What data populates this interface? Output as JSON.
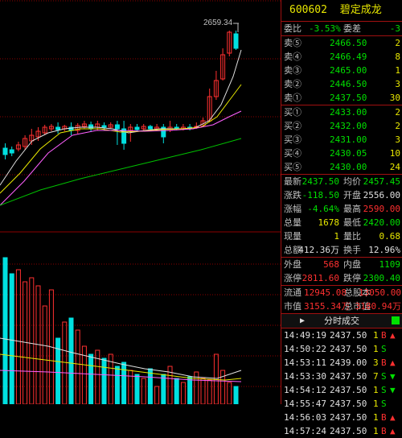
{
  "stock": {
    "code": "600602",
    "name": "碧定成龙"
  },
  "ratio": {
    "wb_label": "委比",
    "wb_value": "-3.53%",
    "wc_label": "委差",
    "wc_value": "-3"
  },
  "sell": [
    {
      "label": "卖⑤",
      "price": "2466.50",
      "vol": "2"
    },
    {
      "label": "卖④",
      "price": "2466.49",
      "vol": "8"
    },
    {
      "label": "卖③",
      "price": "2465.00",
      "vol": "1"
    },
    {
      "label": "卖②",
      "price": "2446.50",
      "vol": "3"
    },
    {
      "label": "卖①",
      "price": "2437.50",
      "vol": "30"
    }
  ],
  "buy": [
    {
      "label": "买①",
      "price": "2433.00",
      "vol": "2"
    },
    {
      "label": "买②",
      "price": "2432.00",
      "vol": "2"
    },
    {
      "label": "买③",
      "price": "2431.00",
      "vol": "3"
    },
    {
      "label": "买④",
      "price": "2430.05",
      "vol": "10"
    },
    {
      "label": "买⑤",
      "price": "2430.00",
      "vol": "24"
    }
  ],
  "quote": [
    {
      "l1": "最新",
      "v1": "2437.50",
      "c1": "g",
      "l2": "均价",
      "v2": "2457.45",
      "c2": "g"
    },
    {
      "l1": "涨跌",
      "v1": "-118.50",
      "c1": "g",
      "l2": "开盘",
      "v2": "2556.00",
      "c2": "w"
    },
    {
      "l1": "涨幅",
      "v1": "-4.64%",
      "c1": "g",
      "l2": "最高",
      "v2": "2590.00",
      "c2": "r"
    },
    {
      "l1": "总量",
      "v1": "1678",
      "c1": "y",
      "l2": "最低",
      "v2": "2420.00",
      "c2": "g"
    },
    {
      "l1": "现量",
      "v1": "1",
      "c1": "y",
      "l2": "量比",
      "v2": "0.68",
      "c2": "y"
    },
    {
      "l1": "总额",
      "v1": "412.36万",
      "c1": "w",
      "l2": "换手",
      "v2": "12.96%",
      "c2": "w"
    }
  ],
  "inout": [
    {
      "l1": "外盘",
      "v1": "568",
      "c1": "r",
      "l2": "内盘",
      "v2": "1109",
      "c2": "g"
    },
    {
      "l1": "涨停",
      "v1": "2811.60",
      "c1": "r",
      "l2": "跌停",
      "v2": "2300.40",
      "c2": "g"
    }
  ],
  "cap": [
    {
      "l1": "流通",
      "v1": "12945.08",
      "l2": "总股本",
      "v2": "13050.00"
    },
    {
      "l1": "市值",
      "v1": "3155.34万",
      "l2": "总市值",
      "v2": "3180.94万"
    }
  ],
  "tab": {
    "arrow": "▶",
    "title": "分时成交"
  },
  "trades": [
    {
      "time": "14:49:19",
      "price": "2437.50",
      "vol": "1",
      "side": "B",
      "dir": "up"
    },
    {
      "time": "14:50:22",
      "price": "2437.50",
      "vol": "1",
      "side": "S",
      "dir": ""
    },
    {
      "time": "14:53:11",
      "price": "2439.00",
      "vol": "3",
      "side": "B",
      "dir": "up"
    },
    {
      "time": "14:53:30",
      "price": "2437.50",
      "vol": "7",
      "side": "S",
      "dir": "down"
    },
    {
      "time": "14:54:12",
      "price": "2437.50",
      "vol": "1",
      "side": "S",
      "dir": "down"
    },
    {
      "time": "14:55:47",
      "price": "2437.50",
      "vol": "1",
      "side": "S",
      "dir": ""
    },
    {
      "time": "14:56:03",
      "price": "2437.50",
      "vol": "1",
      "side": "B",
      "dir": "up"
    },
    {
      "time": "14:57:24",
      "price": "2437.50",
      "vol": "1",
      "side": "B",
      "dir": "up"
    }
  ],
  "chart": {
    "high_label": "2659.34",
    "colors": {
      "up": "#ff3030",
      "down": "#00e0e0",
      "grid": "#8b0000",
      "ma5": "#e0e0e0",
      "ma10": "#e8e800",
      "ma20": "#ff60ff",
      "ma60": "#00c000"
    }
  }
}
